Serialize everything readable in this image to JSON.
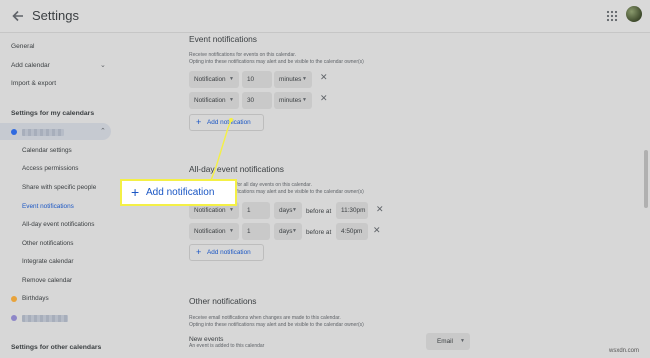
{
  "header": {
    "title": "Settings",
    "back_icon": "arrow-back-icon",
    "apps_icon": "apps-grid-icon"
  },
  "sidebar": {
    "general": "General",
    "add_calendar": "Add calendar",
    "import_export": "Import & export",
    "my_calendars_heading": "Settings for my calendars",
    "calendar_subitems": [
      "Calendar settings",
      "Access permissions",
      "Share with specific people",
      "Event notifications",
      "All-day event notifications",
      "Other notifications",
      "Integrate calendar",
      "Remove calendar"
    ],
    "birthdays": "Birthdays",
    "other_calendars_heading": "Settings for other calendars",
    "colors": {
      "calendar": "#2f6ae0",
      "birthdays": "#e8a33b",
      "other": "#8e87c8",
      "active": "#1a56c4"
    }
  },
  "event_notifications": {
    "title": "Event notifications",
    "desc1": "Receive notifications for events on this calendar.",
    "desc2": "Opting into these notifications may alert and be visible to the calendar owner(s)",
    "rows": [
      {
        "type": "Notification",
        "value": "10",
        "unit": "minutes"
      },
      {
        "type": "Notification",
        "value": "30",
        "unit": "minutes"
      }
    ],
    "add_label": "Add notification"
  },
  "allday_notifications": {
    "title": "All-day event notifications",
    "desc1": "Receive notifications for all day events on this calendar.",
    "desc2": "Opting into these notifications may alert and be visible to the calendar owner(s)",
    "rows": [
      {
        "type": "Notification",
        "value": "1",
        "unit": "days",
        "before": "before at",
        "time": "11:30pm"
      },
      {
        "type": "Notification",
        "value": "1",
        "unit": "days",
        "before": "before at",
        "time": "4:50pm"
      }
    ],
    "add_label": "Add notification"
  },
  "other_notifications": {
    "title": "Other notifications",
    "desc1": "Receive email notifications when changes are made to this calendar.",
    "desc2": "Opting into these notifications may alert and be visible to the calendar owner(s)",
    "new_events_label": "New events",
    "new_events_sub": "An event is added to this calendar",
    "new_events_value": "Email"
  },
  "callout": {
    "label": "Add notification",
    "color": "#f4f046"
  },
  "watermark": "wsxdn.com"
}
